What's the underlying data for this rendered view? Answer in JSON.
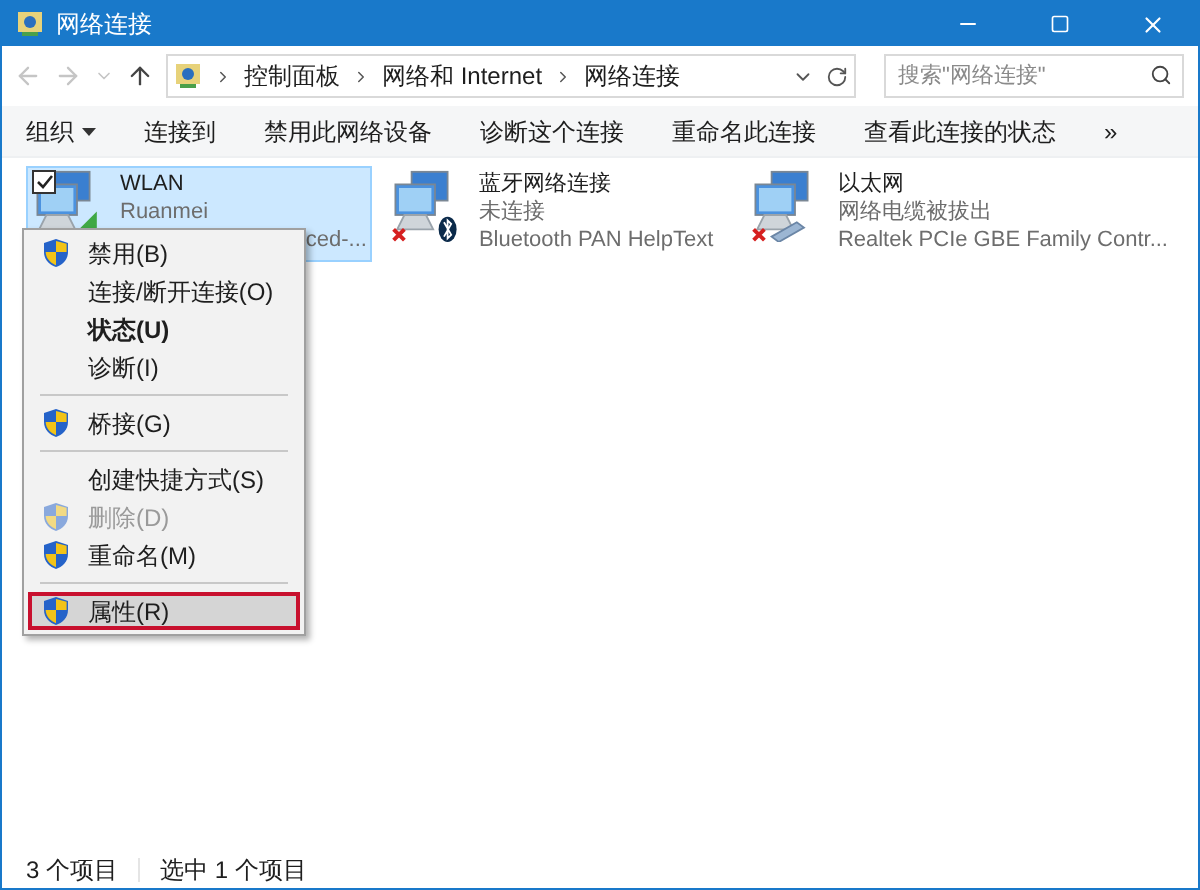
{
  "window": {
    "title": "网络连接"
  },
  "address": {
    "crumbs": [
      "控制面板",
      "网络和 Internet",
      "网络连接"
    ]
  },
  "search": {
    "placeholder": "搜索\"网络连接\""
  },
  "toolbar": {
    "items": [
      {
        "label": "组织",
        "dropdown": true
      },
      {
        "label": "连接到",
        "dropdown": false
      },
      {
        "label": "禁用此网络设备",
        "dropdown": false
      },
      {
        "label": "诊断这个连接",
        "dropdown": false
      },
      {
        "label": "重命名此连接",
        "dropdown": false
      },
      {
        "label": "查看此连接的状态",
        "dropdown": false
      }
    ],
    "more": "»"
  },
  "connections": [
    {
      "name": "WLAN",
      "status": "Ruanmei",
      "device": "ced-...",
      "selected": true,
      "checked": true,
      "kind": "wifi"
    },
    {
      "name": "蓝牙网络连接",
      "status": "未连接",
      "device": "Bluetooth PAN HelpText",
      "selected": false,
      "checked": false,
      "kind": "bluetooth"
    },
    {
      "name": "以太网",
      "status": "网络电缆被拔出",
      "device": "Realtek PCIe GBE Family Contr...",
      "selected": false,
      "checked": false,
      "kind": "ethernet"
    }
  ],
  "context_menu": {
    "items": [
      {
        "kind": "item",
        "label": "禁用(B)",
        "shield": true,
        "bold": false,
        "disabled": false,
        "selected": false
      },
      {
        "kind": "item",
        "label": "连接/断开连接(O)",
        "shield": false,
        "bold": false,
        "disabled": false,
        "selected": false
      },
      {
        "kind": "item",
        "label": "状态(U)",
        "shield": false,
        "bold": true,
        "disabled": false,
        "selected": false
      },
      {
        "kind": "item",
        "label": "诊断(I)",
        "shield": false,
        "bold": false,
        "disabled": false,
        "selected": false
      },
      {
        "kind": "separator"
      },
      {
        "kind": "item",
        "label": "桥接(G)",
        "shield": true,
        "bold": false,
        "disabled": false,
        "selected": false
      },
      {
        "kind": "separator"
      },
      {
        "kind": "item",
        "label": "创建快捷方式(S)",
        "shield": false,
        "bold": false,
        "disabled": false,
        "selected": false
      },
      {
        "kind": "item",
        "label": "删除(D)",
        "shield": true,
        "bold": false,
        "disabled": true,
        "selected": false
      },
      {
        "kind": "item",
        "label": "重命名(M)",
        "shield": true,
        "bold": false,
        "disabled": false,
        "selected": false
      },
      {
        "kind": "separator"
      },
      {
        "kind": "item",
        "label": "属性(R)",
        "shield": true,
        "bold": false,
        "disabled": false,
        "selected": true
      }
    ]
  },
  "status_bar": {
    "count": "3 个项目",
    "selection": "选中 1 个项目"
  }
}
